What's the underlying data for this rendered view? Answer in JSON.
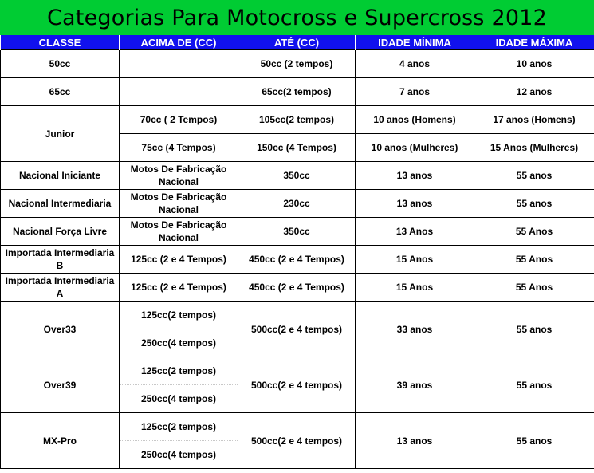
{
  "title": "Categorias Para Motocross e Supercross 2012",
  "colors": {
    "title_bg": "#00cc33",
    "header_bg": "#1111ee",
    "header_text": "#ffffff"
  },
  "headers": [
    "CLASSE",
    "ACIMA DE (CC)",
    "ATÉ (CC)",
    "IDADE MÍNIMA",
    "IDADE MÁXIMA"
  ],
  "rows": {
    "r50": {
      "classe": "50cc",
      "acima": "",
      "ate": "50cc (2 tempos)",
      "min": "4 anos",
      "max": "10 anos"
    },
    "r65": {
      "classe": "65cc",
      "acima": "",
      "ate": "65cc(2 tempos)",
      "min": "7 anos",
      "max": "12 anos"
    },
    "junior": {
      "classe": "Junior",
      "a": {
        "acima": "70cc ( 2 Tempos)",
        "ate": "105cc(2 tempos)",
        "min": "10 anos (Homens)",
        "max": "17 anos (Homens)"
      },
      "b": {
        "acima": "75cc (4 Tempos)",
        "ate": "150cc (4 Tempos)",
        "min": "10 anos (Mulheres)",
        "max": "15 Anos (Mulheres)"
      }
    },
    "nac_ini": {
      "classe": "Nacional Iniciante",
      "acima": "Motos De Fabricação Nacional",
      "ate": "350cc",
      "min": "13 anos",
      "max": "55 anos"
    },
    "nac_int": {
      "classe": "Nacional Intermediaria",
      "acima": "Motos De Fabricação Nacional",
      "ate": "230cc",
      "min": "13 anos",
      "max": "55 anos"
    },
    "nac_fl": {
      "classe": "Nacional Força Livre",
      "acima": "Motos De Fabricação Nacional",
      "ate": "350cc",
      "min": "13 Anos",
      "max": "55 Anos"
    },
    "imp_b": {
      "classe": "Importada Intermediaria B",
      "acima": "125cc (2 e 4 Tempos)",
      "ate": "450cc (2 e 4 Tempos)",
      "min": "15 Anos",
      "max": "55 Anos"
    },
    "imp_a": {
      "classe": "Importada Intermediaria A",
      "acima": "125cc (2 e 4 Tempos)",
      "ate": "450cc (2 e 4 Tempos)",
      "min": "15 Anos",
      "max": "55 Anos"
    },
    "over33": {
      "classe": "Over33",
      "acima_a": "125cc(2 tempos)",
      "acima_b": "250cc(4 tempos)",
      "ate": "500cc(2 e 4 tempos)",
      "min": "33 anos",
      "max": "55 anos"
    },
    "over39": {
      "classe": "Over39",
      "acima_a": "125cc(2 tempos)",
      "acima_b": "250cc(4 tempos)",
      "ate": "500cc(2 e 4 tempos)",
      "min": "39 anos",
      "max": "55 anos"
    },
    "mxpro": {
      "classe": "MX-Pro",
      "acima_a": "125cc(2 tempos)",
      "acima_b": "250cc(4 tempos)",
      "ate": "500cc(2 e 4 tempos)",
      "min": "13 anos",
      "max": "55 anos"
    }
  }
}
